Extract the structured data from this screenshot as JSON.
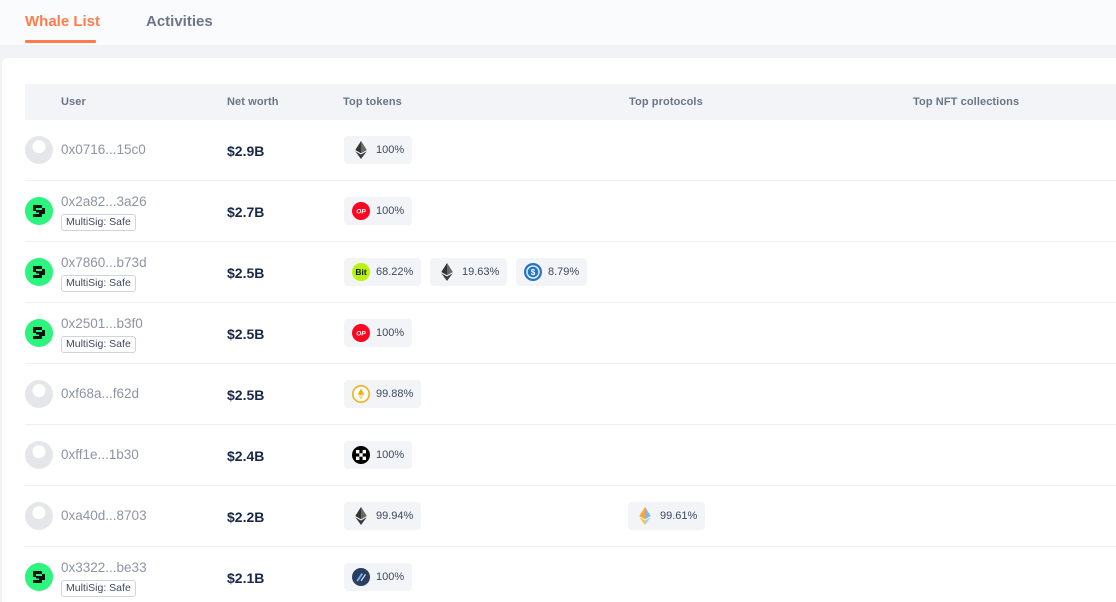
{
  "tabs": [
    {
      "label": "Whale List",
      "active": true
    },
    {
      "label": "Activities",
      "active": false
    }
  ],
  "columns": {
    "user": "User",
    "net_worth": "Net worth",
    "top_tokens": "Top tokens",
    "top_protocols": "Top protocols",
    "top_nft": "Top NFT collections"
  },
  "colors": {
    "accent": "#ff7c4a",
    "safe_green": "#2cf57e",
    "op_red": "#ff0420"
  },
  "rows": [
    {
      "address": "0x0716...15c0",
      "badge": "",
      "net_worth": "$2.9B",
      "tokens": [
        {
          "icon": "eth-icon",
          "pct": "100%"
        }
      ],
      "protocols": []
    },
    {
      "address": "0x2a82...3a26",
      "badge": "MultiSig: Safe",
      "net_worth": "$2.7B",
      "tokens": [
        {
          "icon": "op-icon",
          "pct": "100%"
        }
      ],
      "protocols": []
    },
    {
      "address": "0x7860...b73d",
      "badge": "MultiSig: Safe",
      "net_worth": "$2.5B",
      "tokens": [
        {
          "icon": "bit-icon",
          "pct": "68.22%"
        },
        {
          "icon": "eth-icon",
          "pct": "19.63%"
        },
        {
          "icon": "usdc-icon",
          "pct": "8.79%"
        }
      ],
      "protocols": []
    },
    {
      "address": "0x2501...b3f0",
      "badge": "MultiSig: Safe",
      "net_worth": "$2.5B",
      "tokens": [
        {
          "icon": "op-icon",
          "pct": "100%"
        }
      ],
      "protocols": []
    },
    {
      "address": "0xf68a...f62d",
      "badge": "",
      "net_worth": "$2.5B",
      "tokens": [
        {
          "icon": "weth-gold-icon",
          "pct": "99.88%"
        }
      ],
      "protocols": []
    },
    {
      "address": "0xff1e...1b30",
      "badge": "",
      "net_worth": "$2.4B",
      "tokens": [
        {
          "icon": "okb-icon",
          "pct": "100%"
        }
      ],
      "protocols": []
    },
    {
      "address": "0xa40d...8703",
      "badge": "",
      "net_worth": "$2.2B",
      "tokens": [
        {
          "icon": "eth-icon",
          "pct": "99.94%"
        }
      ],
      "protocols": [
        {
          "icon": "eth2-staking-icon",
          "pct": "99.61%"
        }
      ]
    },
    {
      "address": "0x3322...be33",
      "badge": "MultiSig: Safe",
      "net_worth": "$2.1B",
      "tokens": [
        {
          "icon": "matic-icon",
          "pct": "100%"
        }
      ],
      "protocols": []
    }
  ]
}
